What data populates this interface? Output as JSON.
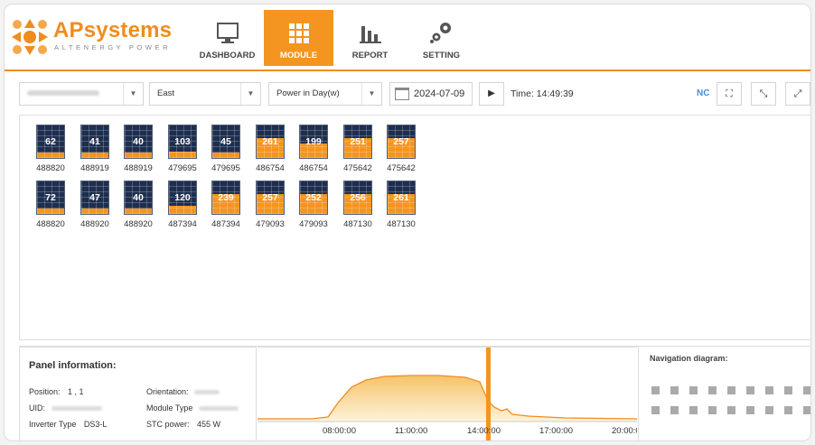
{
  "brand": {
    "name": "APsystems",
    "tagline": "ALTENERGY POWER"
  },
  "nav": [
    {
      "label": "DASHBOARD",
      "icon": "monitor-icon",
      "active": false
    },
    {
      "label": "MODULE",
      "icon": "grid-icon",
      "active": true
    },
    {
      "label": "REPORT",
      "icon": "bar-chart-icon",
      "active": false
    },
    {
      "label": "SETTING",
      "icon": "gears-icon",
      "active": false
    }
  ],
  "toolbar": {
    "orientation_value": "East",
    "mode_value": "Power in Day(w)",
    "date": "2024-07-09",
    "time": "Time: 14:49:39",
    "nc_label": "NC"
  },
  "modules": [
    {
      "value": "62",
      "id": "488820",
      "level": 0.18
    },
    {
      "value": "41",
      "id": "488919",
      "level": 0.16
    },
    {
      "value": "40",
      "id": "488919",
      "level": 0.16
    },
    {
      "value": "103",
      "id": "479695",
      "level": 0.2
    },
    {
      "value": "45",
      "id": "479695",
      "level": 0.17
    },
    {
      "value": "261",
      "id": "486754",
      "level": 0.6
    },
    {
      "value": "199",
      "id": "486754",
      "level": 0.45
    },
    {
      "value": "251",
      "id": "475642",
      "level": 0.6
    },
    {
      "value": "257",
      "id": "475642",
      "level": 0.62
    },
    {
      "value": "72",
      "id": "488820",
      "level": 0.18
    },
    {
      "value": "47",
      "id": "488920",
      "level": 0.17
    },
    {
      "value": "40",
      "id": "488920",
      "level": 0.16
    },
    {
      "value": "120",
      "id": "487394",
      "level": 0.25
    },
    {
      "value": "239",
      "id": "487394",
      "level": 0.6
    },
    {
      "value": "257",
      "id": "479093",
      "level": 0.6
    },
    {
      "value": "252",
      "id": "479093",
      "level": 0.6
    },
    {
      "value": "256",
      "id": "487130",
      "level": 0.6
    },
    {
      "value": "261",
      "id": "487130",
      "level": 0.62
    }
  ],
  "panel_info": {
    "title": "Panel information:",
    "position_label": "Position:",
    "position_value": "1 , 1",
    "uid_label": "UID:",
    "inverter_label": "Inverter Type",
    "inverter_value": "DS3-L",
    "orientation_label": "Orientation:",
    "module_type_label": "Module Type",
    "stc_label": "STC power:",
    "stc_value": "455 W"
  },
  "chart_data": {
    "type": "area",
    "x_ticks": [
      "08:00:00",
      "11:00:00",
      "14:00:00",
      "17:00:00",
      "20:00:00"
    ],
    "cursor_time": "14:49:39"
  },
  "navigation": {
    "title": "Navigation diagram:"
  },
  "colors": {
    "accent": "#f39520",
    "panel": "#1d2e4f",
    "nc": "#4a8fd6"
  }
}
